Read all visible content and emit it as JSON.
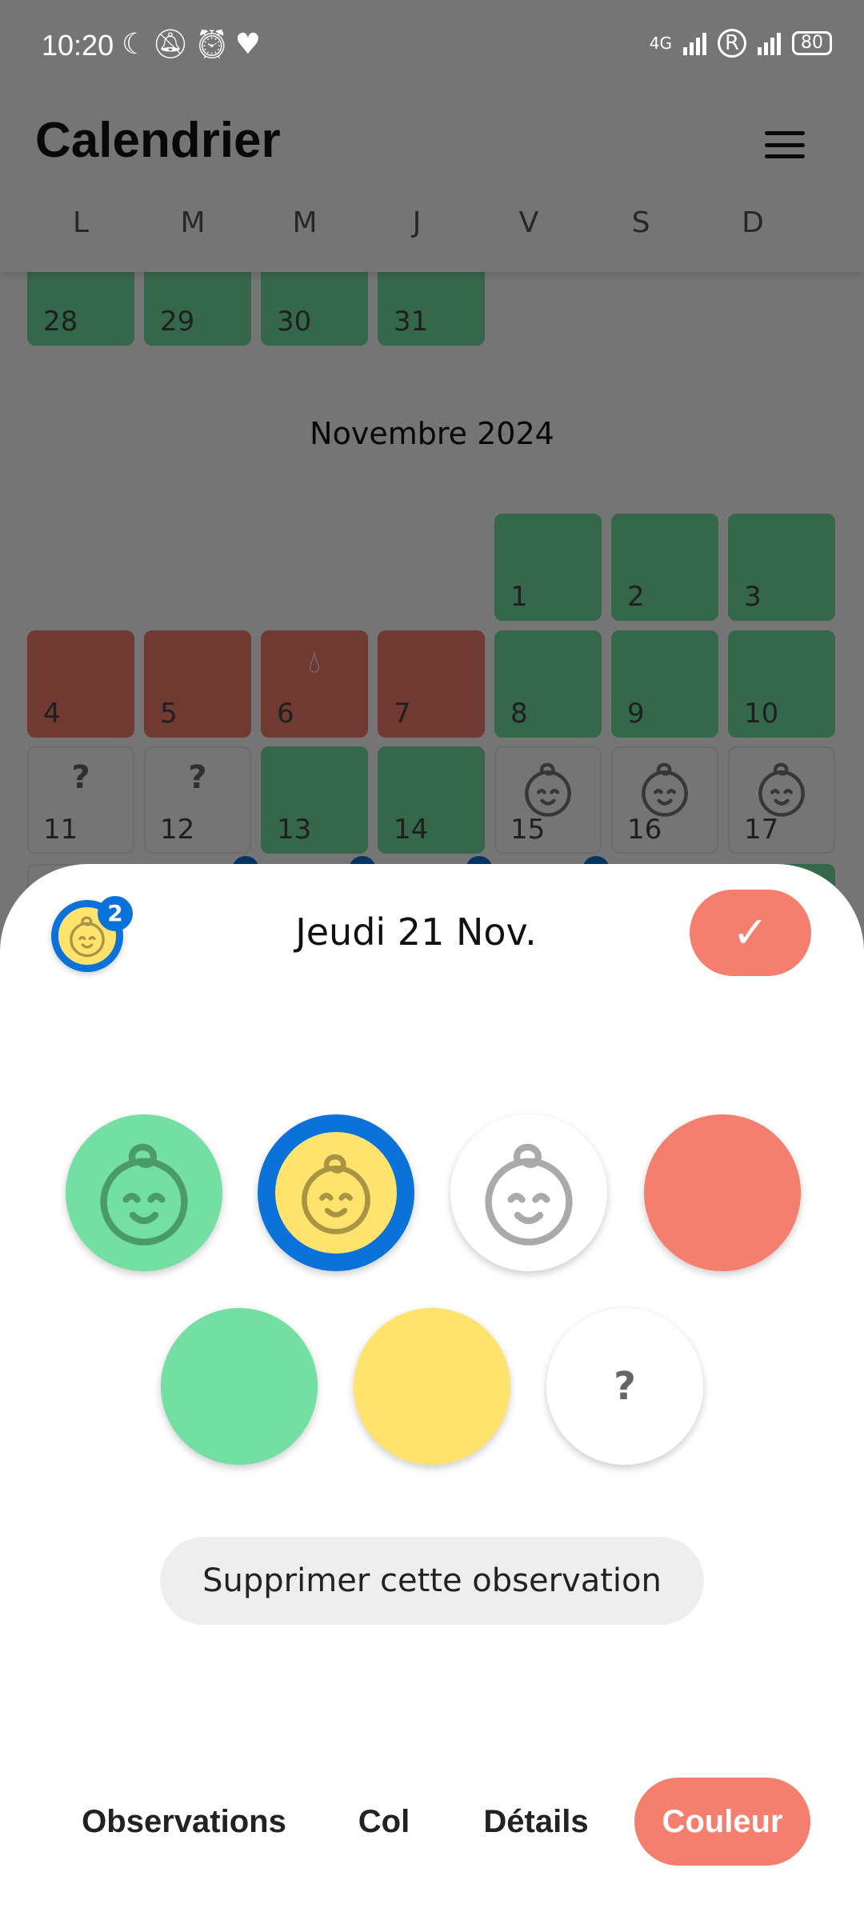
{
  "status": {
    "time": "10:20",
    "icons": [
      "moon-icon",
      "vibrate-off-icon",
      "alarm-icon",
      "heart-icon"
    ],
    "network": "4G",
    "roaming": "R",
    "battery": "80"
  },
  "header": {
    "title": "Calendrier",
    "weekdays": [
      "L",
      "M",
      "M",
      "J",
      "V",
      "S",
      "D"
    ]
  },
  "colors": {
    "green": "#74DFA2",
    "red": "#F47F6F",
    "yellow": "#FFE36D",
    "blue": "#0A72D8"
  },
  "calendar": {
    "prev_month_tail": [
      {
        "day": "28",
        "state": "green"
      },
      {
        "day": "29",
        "state": "green"
      },
      {
        "day": "30",
        "state": "green"
      },
      {
        "day": "31",
        "state": "green"
      }
    ],
    "month_label": "Novembre 2024",
    "days": [
      {
        "day": "1",
        "state": "green"
      },
      {
        "day": "2",
        "state": "green"
      },
      {
        "day": "3",
        "state": "green"
      },
      {
        "day": "4",
        "state": "red"
      },
      {
        "day": "5",
        "state": "red"
      },
      {
        "day": "6",
        "state": "red",
        "icon": "drop-icon"
      },
      {
        "day": "7",
        "state": "red"
      },
      {
        "day": "8",
        "state": "green"
      },
      {
        "day": "9",
        "state": "green"
      },
      {
        "day": "10",
        "state": "green"
      },
      {
        "day": "11",
        "state": "white",
        "icon": "question-icon"
      },
      {
        "day": "12",
        "state": "white",
        "icon": "question-icon"
      },
      {
        "day": "13",
        "state": "green"
      },
      {
        "day": "14",
        "state": "green"
      },
      {
        "day": "15",
        "state": "white",
        "icon": "baby-icon"
      },
      {
        "day": "16",
        "state": "white",
        "icon": "baby-icon"
      },
      {
        "day": "17",
        "state": "white",
        "icon": "baby-icon"
      }
    ],
    "partial_row": [
      "white",
      "yellow-badge",
      "yellow-badge",
      "yellow-badge",
      "yellow-badge",
      "green",
      "green"
    ]
  },
  "sheet": {
    "title": "Jeudi 21 Nov.",
    "badge_count": "2",
    "confirm_icon": "check-icon",
    "options": [
      {
        "name": "green-baby",
        "color": "#74DFA2",
        "icon": "baby-icon",
        "selected": false
      },
      {
        "name": "yellow-baby",
        "color": "#FFE36D",
        "icon": "baby-icon",
        "selected": true
      },
      {
        "name": "white-baby",
        "color": "#FFFFFF",
        "icon": "baby-icon",
        "selected": false
      },
      {
        "name": "red",
        "color": "#F47F6F",
        "selected": false
      },
      {
        "name": "green",
        "color": "#74DFA2",
        "selected": false
      },
      {
        "name": "yellow",
        "color": "#FFE36D",
        "selected": false
      },
      {
        "name": "unknown",
        "color": "#FFFFFF",
        "icon": "question-icon",
        "label": "?",
        "selected": false
      }
    ],
    "delete_label": "Supprimer cette observation"
  },
  "tabs": [
    {
      "label": "Observations"
    },
    {
      "label": "Col"
    },
    {
      "label": "Détails"
    },
    {
      "label": "Couleur",
      "active": true
    }
  ]
}
